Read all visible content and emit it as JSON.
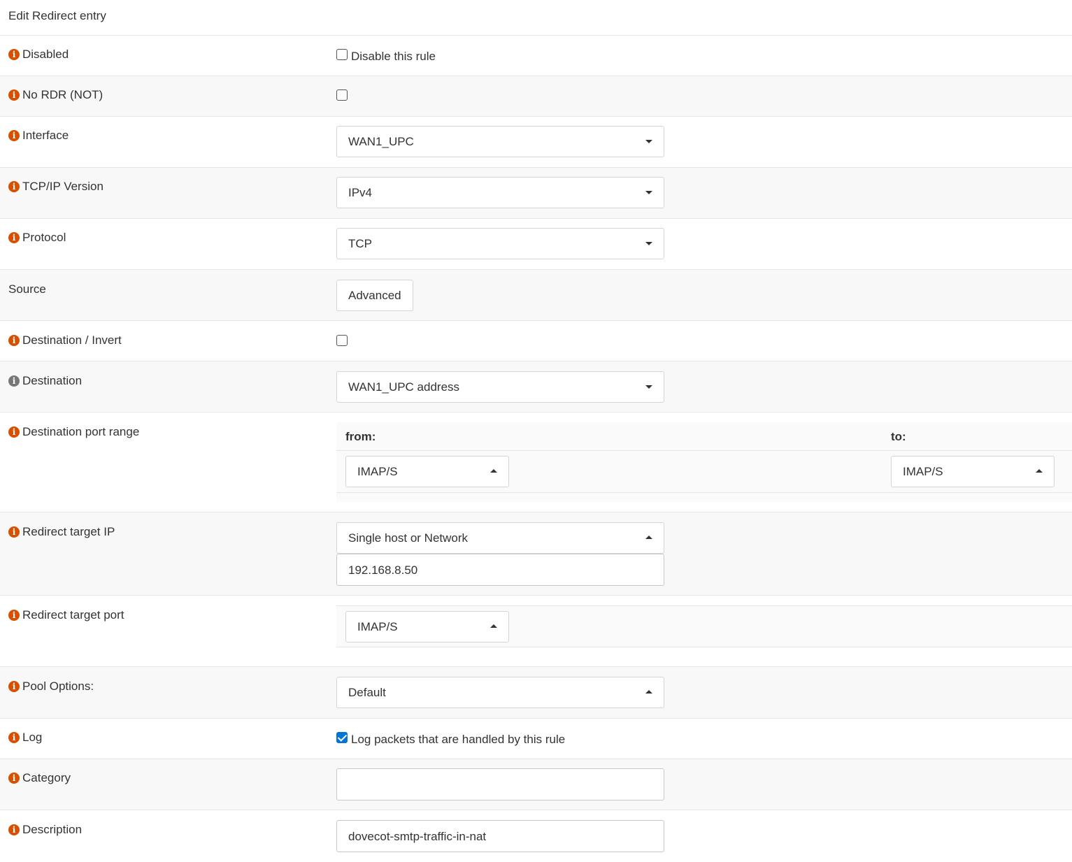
{
  "header": {
    "title": "Edit Redirect entry"
  },
  "rows": {
    "disabled": {
      "label": "Disabled",
      "checkbox_label": "Disable this rule",
      "checked": false
    },
    "no_rdr": {
      "label": "No RDR (NOT)",
      "checked": false
    },
    "interface": {
      "label": "Interface",
      "value": "WAN1_UPC"
    },
    "tcpip_version": {
      "label": "TCP/IP Version",
      "value": "IPv4"
    },
    "protocol": {
      "label": "Protocol",
      "value": "TCP"
    },
    "source": {
      "label": "Source",
      "button_label": "Advanced"
    },
    "destination_invert": {
      "label": "Destination / Invert",
      "checked": false
    },
    "destination": {
      "label": "Destination",
      "value": "WAN1_UPC address"
    },
    "destination_port_range": {
      "label": "Destination port range",
      "from_label": "from:",
      "to_label": "to:",
      "from_value": "IMAP/S",
      "to_value": "IMAP/S"
    },
    "redirect_target_ip": {
      "label": "Redirect target IP",
      "type_value": "Single host or Network",
      "address_value": "192.168.8.50"
    },
    "redirect_target_port": {
      "label": "Redirect target port",
      "value": "IMAP/S"
    },
    "pool_options": {
      "label": "Pool Options:",
      "value": "Default"
    },
    "log": {
      "label": "Log",
      "checkbox_label": "Log packets that are handled by this rule",
      "checked": true
    },
    "category": {
      "label": "Category",
      "value": ""
    },
    "description": {
      "label": "Description",
      "value": "dovecot-smtp-traffic-in-nat"
    }
  },
  "icons": {
    "info": "info-circle-icon"
  },
  "colors": {
    "info_icon": "#d94f00",
    "info_icon_muted": "#777777",
    "checkbox_checked": "#0075d8"
  }
}
